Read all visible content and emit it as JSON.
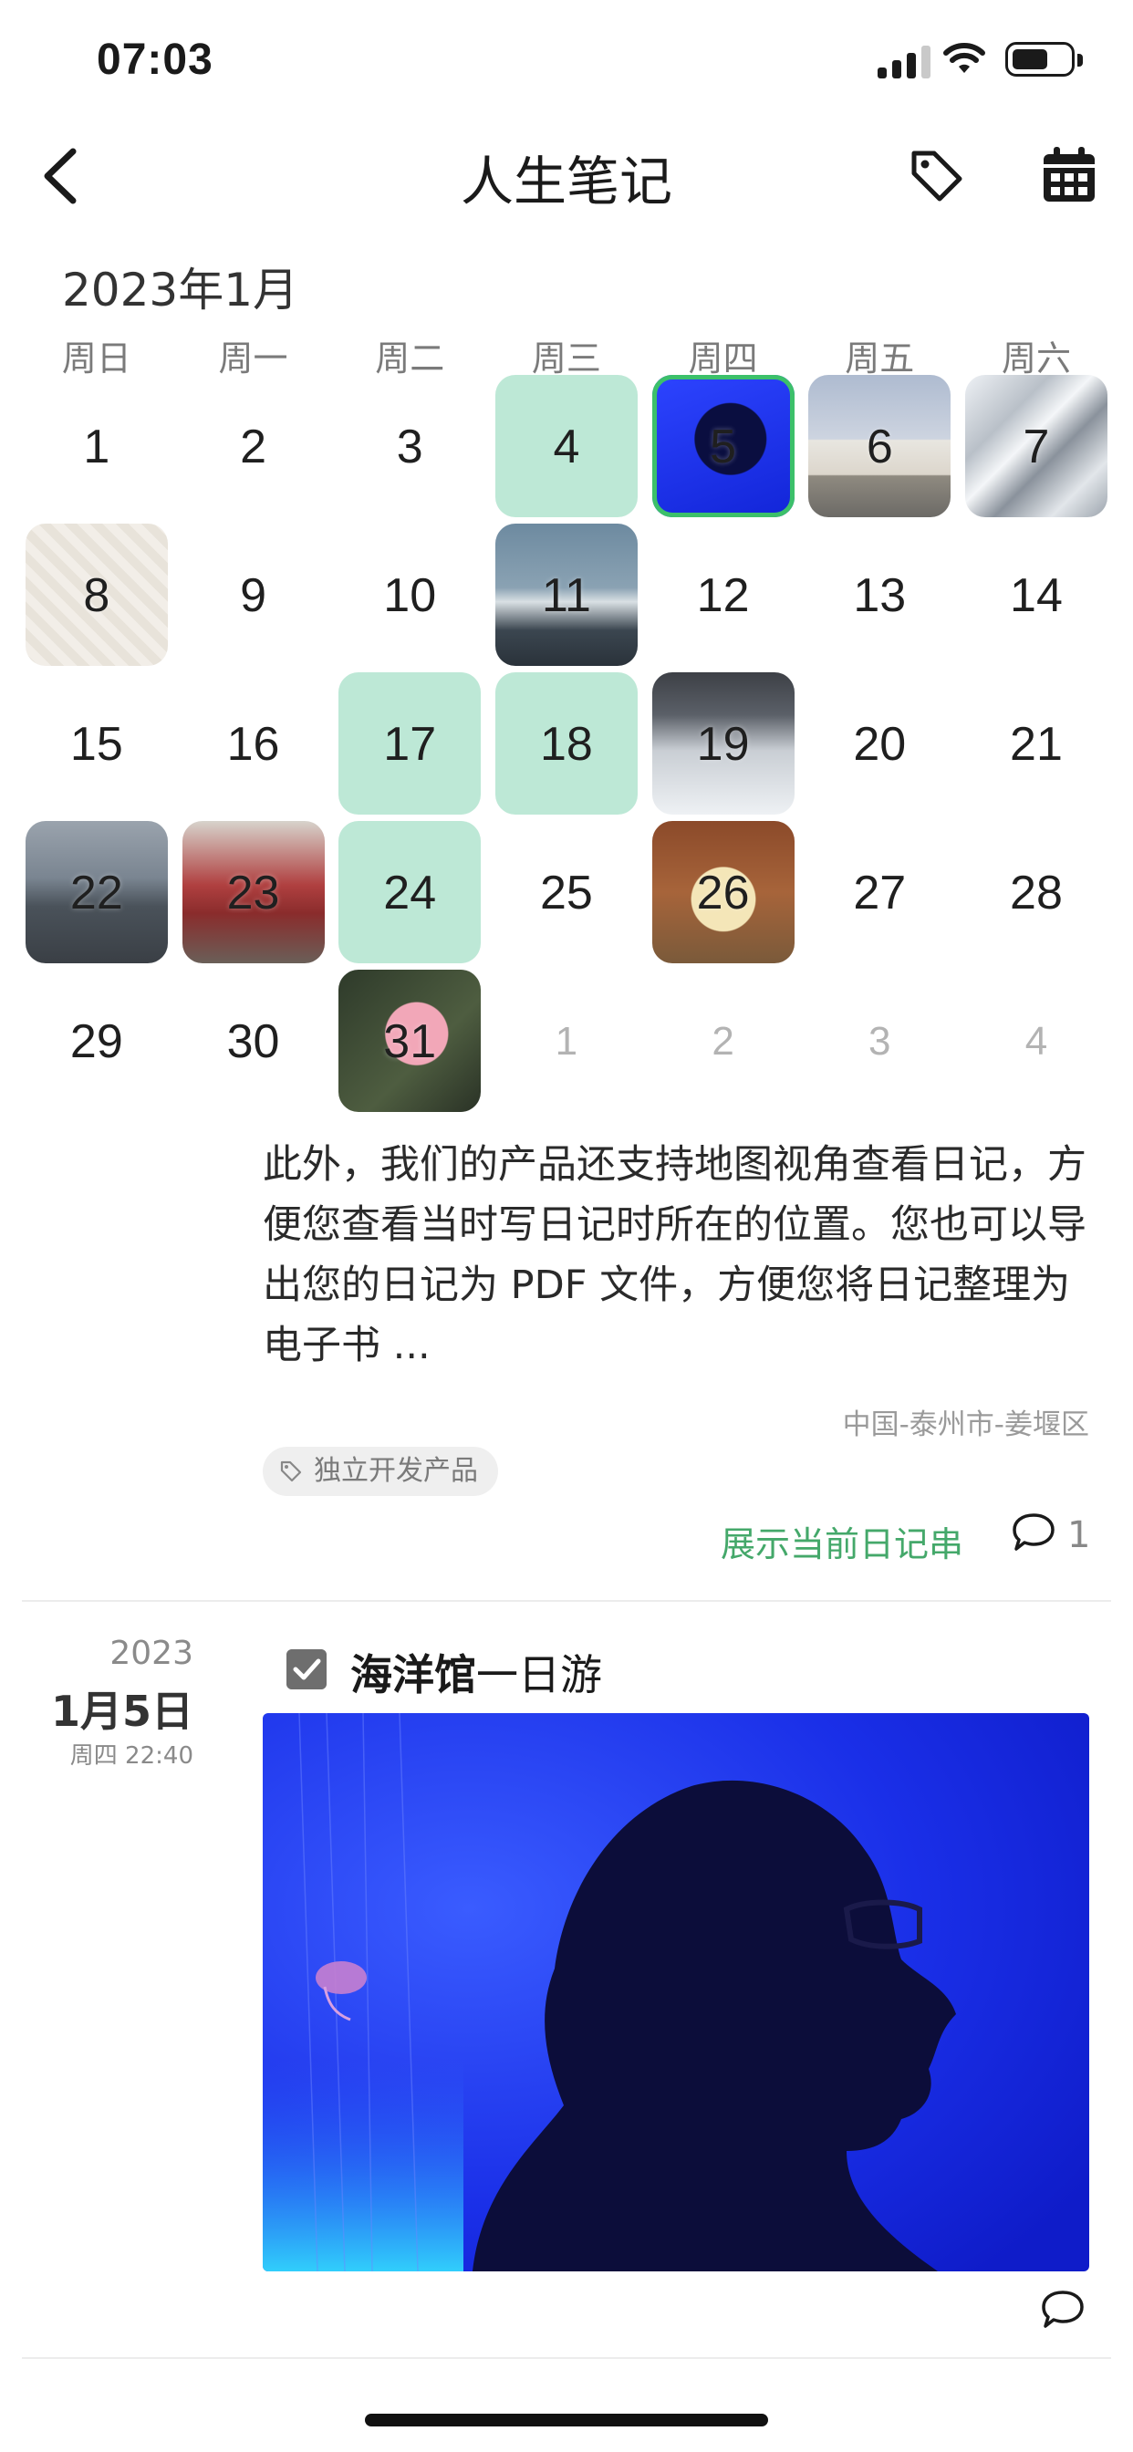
{
  "status_bar": {
    "time": "07:03"
  },
  "nav": {
    "title": "人生笔记",
    "back_icon": "chevron-left-icon",
    "tag_icon": "tag-icon",
    "calendar_icon": "calendar-icon"
  },
  "calendar": {
    "month_label": "2023年1月",
    "weekdays": [
      "周日",
      "周一",
      "周二",
      "周三",
      "周四",
      "周五",
      "周六"
    ],
    "cells": [
      {
        "label": "1"
      },
      {
        "label": "2"
      },
      {
        "label": "3"
      },
      {
        "label": "4",
        "mark": "mint"
      },
      {
        "label": "5",
        "mark": "photo",
        "photo": "aquarium",
        "selected": true
      },
      {
        "label": "6",
        "mark": "photo",
        "photo": "building"
      },
      {
        "label": "7",
        "mark": "photo",
        "photo": "snow"
      },
      {
        "label": "8",
        "mark": "photo",
        "photo": "doodle"
      },
      {
        "label": "9"
      },
      {
        "label": "10"
      },
      {
        "label": "11",
        "mark": "photo",
        "photo": "mountain"
      },
      {
        "label": "12"
      },
      {
        "label": "13"
      },
      {
        "label": "14"
      },
      {
        "label": "15"
      },
      {
        "label": "16"
      },
      {
        "label": "17",
        "mark": "mint"
      },
      {
        "label": "18",
        "mark": "mint"
      },
      {
        "label": "19",
        "mark": "photo",
        "photo": "car"
      },
      {
        "label": "20"
      },
      {
        "label": "21"
      },
      {
        "label": "22",
        "mark": "photo",
        "photo": "bridge"
      },
      {
        "label": "23",
        "mark": "photo",
        "photo": "crowd"
      },
      {
        "label": "24",
        "mark": "mint"
      },
      {
        "label": "25"
      },
      {
        "label": "26",
        "mark": "photo",
        "photo": "toy"
      },
      {
        "label": "27"
      },
      {
        "label": "28"
      },
      {
        "label": "29"
      },
      {
        "label": "30"
      },
      {
        "label": "31",
        "mark": "photo",
        "photo": "flower"
      },
      {
        "label": "1",
        "other": true
      },
      {
        "label": "2",
        "other": true
      },
      {
        "label": "3",
        "other": true
      },
      {
        "label": "4",
        "other": true
      }
    ]
  },
  "entry1": {
    "excerpt": "此外，我们的产品还支持地图视角查看日记，方便您查看当时写日记时所在的位置。您也可以导出您的日记为 PDF 文件，方便您将日记整理为电子书 ...",
    "location": "中国-泰州市-姜堰区",
    "tag": "独立开发产品",
    "show_thread": "展示当前日记串",
    "comment_count": "1"
  },
  "entry2": {
    "year": "2023",
    "date": "1月5日",
    "weekday_time": "周四 22:40",
    "title_bold": "海洋馆",
    "title_rest": "一日游",
    "photo": "aquarium silhouette"
  },
  "colors": {
    "mint": "#bde8d6",
    "accent_green": "#44a86a",
    "selected_border": "#3cc06a"
  }
}
